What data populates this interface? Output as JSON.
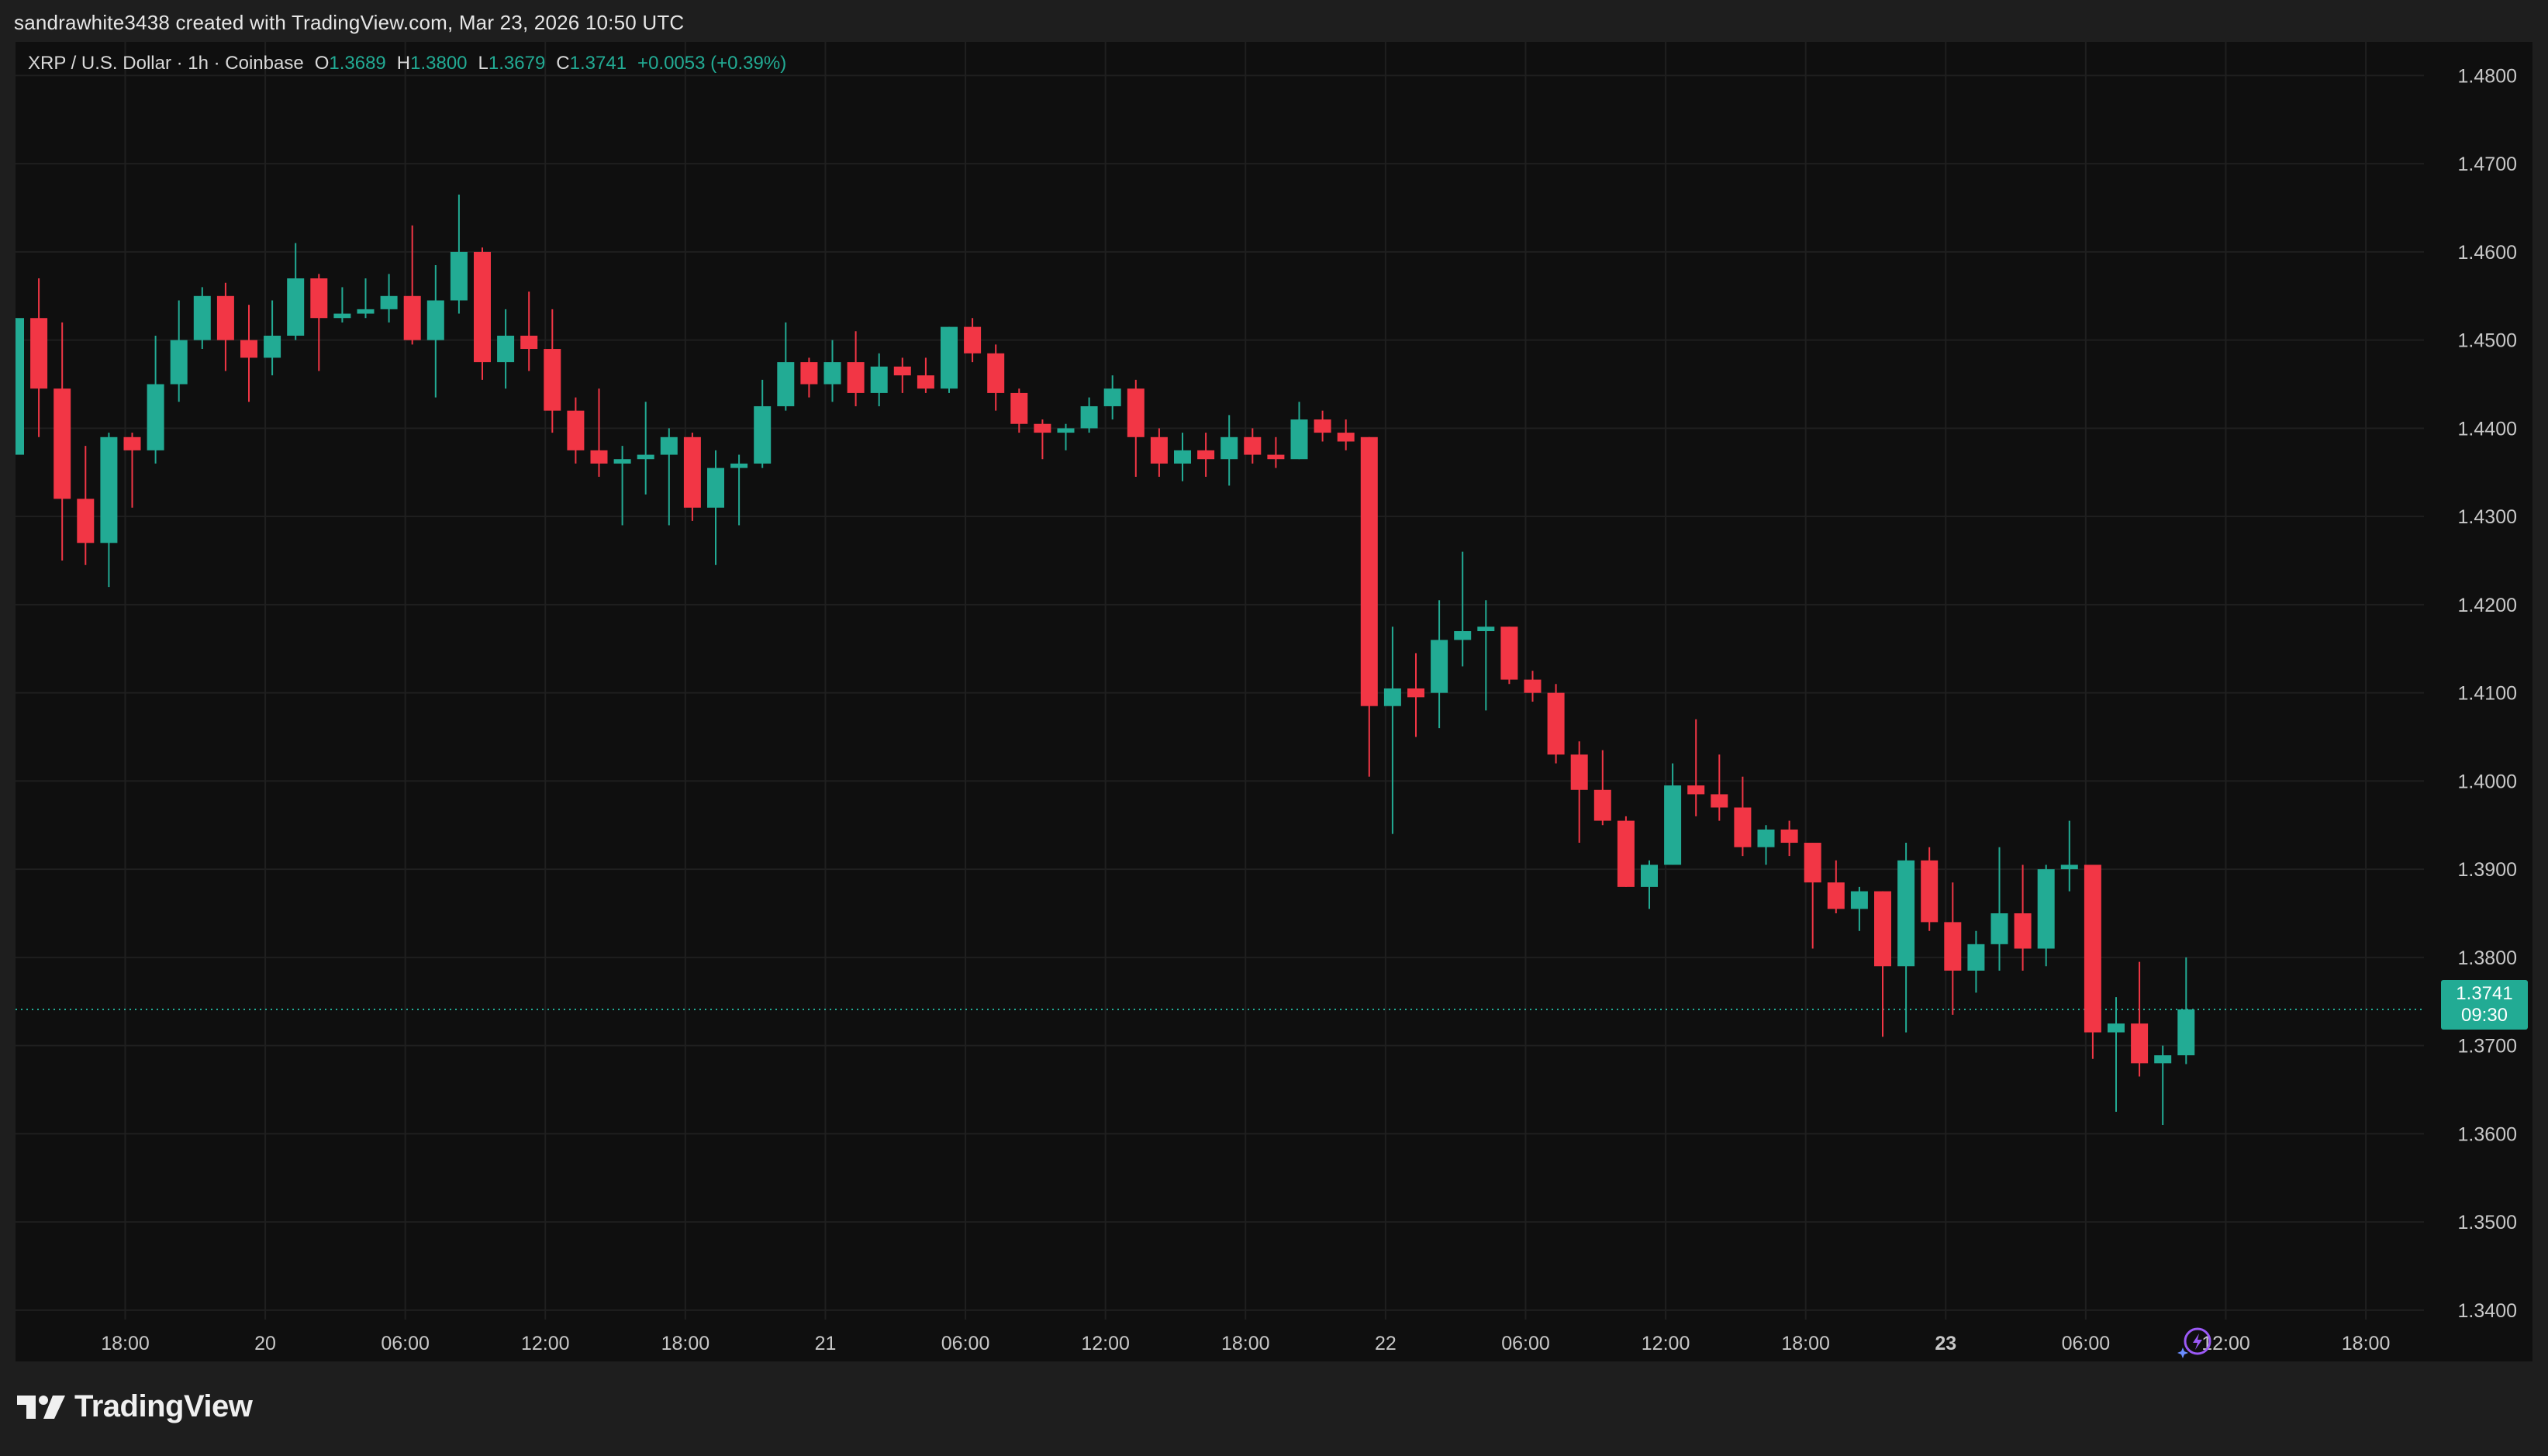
{
  "attribution": "sandrawhite3438 created with TradingView.com, Mar 23, 2026 10:50 UTC",
  "legend": {
    "symbol": "XRP / U.S. Dollar · 1h · Coinbase",
    "o_label": "O",
    "o_value": "1.3689",
    "h_label": "H",
    "h_value": "1.3800",
    "l_label": "L",
    "l_value": "1.3679",
    "c_label": "C",
    "c_value": "1.3741",
    "change": "+0.0053 (+0.39%)"
  },
  "price_badge": {
    "price": "1.3741",
    "countdown": "09:30"
  },
  "logo": {
    "text": "TradingView"
  },
  "colors": {
    "up": "#22ab94",
    "down": "#f23645",
    "grid": "#1f1f1f",
    "axis_text": "#c8c8c8",
    "background": "#0f0f0f"
  },
  "chart_data": {
    "type": "candlestick",
    "symbol": "XRP / U.S. Dollar",
    "interval": "1h",
    "exchange": "Coinbase",
    "ylim": [
      1.337,
      1.4825
    ],
    "y_ticks": [
      "1.4800",
      "1.4700",
      "1.4600",
      "1.4500",
      "1.4400",
      "1.4300",
      "1.4200",
      "1.4100",
      "1.4000",
      "1.3900",
      "1.3800",
      "1.3700",
      "1.3600",
      "1.3500",
      "1.3400"
    ],
    "x_ticks": [
      {
        "label": "18:00",
        "i": 4.7
      },
      {
        "label": "20",
        "i": 10.7
      },
      {
        "label": "06:00",
        "i": 16.7
      },
      {
        "label": "12:00",
        "i": 22.7
      },
      {
        "label": "18:00",
        "i": 28.7
      },
      {
        "label": "21",
        "i": 34.7
      },
      {
        "label": "06:00",
        "i": 40.7
      },
      {
        "label": "12:00",
        "i": 46.7
      },
      {
        "label": "18:00",
        "i": 52.7
      },
      {
        "label": "22",
        "i": 58.7
      },
      {
        "label": "06:00",
        "i": 64.7
      },
      {
        "label": "12:00",
        "i": 70.7
      },
      {
        "label": "18:00",
        "i": 76.7
      },
      {
        "label": "23",
        "i": 82.7,
        "bold": true
      },
      {
        "label": "06:00",
        "i": 88.7
      },
      {
        "label": "12:00",
        "i": 94.7
      },
      {
        "label": "18:00",
        "i": 100.7
      }
    ],
    "last_price": 1.3741,
    "candles": [
      {
        "o": 1.437,
        "h": 1.4525,
        "l": 1.437,
        "c": 1.4525
      },
      {
        "o": 1.4525,
        "h": 1.457,
        "l": 1.439,
        "c": 1.4445
      },
      {
        "o": 1.4445,
        "h": 1.452,
        "l": 1.425,
        "c": 1.432
      },
      {
        "o": 1.432,
        "h": 1.438,
        "l": 1.4245,
        "c": 1.427
      },
      {
        "o": 1.427,
        "h": 1.4395,
        "l": 1.422,
        "c": 1.439
      },
      {
        "o": 1.439,
        "h": 1.4395,
        "l": 1.431,
        "c": 1.4375
      },
      {
        "o": 1.4375,
        "h": 1.4505,
        "l": 1.436,
        "c": 1.445
      },
      {
        "o": 1.445,
        "h": 1.4545,
        "l": 1.443,
        "c": 1.45
      },
      {
        "o": 1.45,
        "h": 1.456,
        "l": 1.449,
        "c": 1.455
      },
      {
        "o": 1.455,
        "h": 1.4565,
        "l": 1.4465,
        "c": 1.45
      },
      {
        "o": 1.45,
        "h": 1.454,
        "l": 1.443,
        "c": 1.448
      },
      {
        "o": 1.448,
        "h": 1.4545,
        "l": 1.446,
        "c": 1.4505
      },
      {
        "o": 1.4505,
        "h": 1.461,
        "l": 1.45,
        "c": 1.457
      },
      {
        "o": 1.457,
        "h": 1.4575,
        "l": 1.4465,
        "c": 1.4525
      },
      {
        "o": 1.4525,
        "h": 1.456,
        "l": 1.452,
        "c": 1.453
      },
      {
        "o": 1.453,
        "h": 1.457,
        "l": 1.4525,
        "c": 1.4535
      },
      {
        "o": 1.4535,
        "h": 1.4575,
        "l": 1.452,
        "c": 1.455
      },
      {
        "o": 1.455,
        "h": 1.463,
        "l": 1.4495,
        "c": 1.45
      },
      {
        "o": 1.45,
        "h": 1.4585,
        "l": 1.4435,
        "c": 1.4545
      },
      {
        "o": 1.4545,
        "h": 1.4665,
        "l": 1.453,
        "c": 1.46
      },
      {
        "o": 1.46,
        "h": 1.4605,
        "l": 1.4455,
        "c": 1.4475
      },
      {
        "o": 1.4475,
        "h": 1.4535,
        "l": 1.4445,
        "c": 1.4505
      },
      {
        "o": 1.4505,
        "h": 1.4555,
        "l": 1.4465,
        "c": 1.449
      },
      {
        "o": 1.449,
        "h": 1.4535,
        "l": 1.4395,
        "c": 1.442
      },
      {
        "o": 1.442,
        "h": 1.4435,
        "l": 1.436,
        "c": 1.4375
      },
      {
        "o": 1.4375,
        "h": 1.4445,
        "l": 1.4345,
        "c": 1.436
      },
      {
        "o": 1.436,
        "h": 1.438,
        "l": 1.429,
        "c": 1.4365
      },
      {
        "o": 1.4365,
        "h": 1.443,
        "l": 1.4325,
        "c": 1.437
      },
      {
        "o": 1.437,
        "h": 1.44,
        "l": 1.429,
        "c": 1.439
      },
      {
        "o": 1.439,
        "h": 1.4395,
        "l": 1.4295,
        "c": 1.431
      },
      {
        "o": 1.431,
        "h": 1.4375,
        "l": 1.4245,
        "c": 1.4355
      },
      {
        "o": 1.4355,
        "h": 1.437,
        "l": 1.429,
        "c": 1.436
      },
      {
        "o": 1.436,
        "h": 1.4455,
        "l": 1.4355,
        "c": 1.4425
      },
      {
        "o": 1.4425,
        "h": 1.452,
        "l": 1.442,
        "c": 1.4475
      },
      {
        "o": 1.4475,
        "h": 1.448,
        "l": 1.4435,
        "c": 1.445
      },
      {
        "o": 1.445,
        "h": 1.45,
        "l": 1.443,
        "c": 1.4475
      },
      {
        "o": 1.4475,
        "h": 1.451,
        "l": 1.4425,
        "c": 1.444
      },
      {
        "o": 1.444,
        "h": 1.4485,
        "l": 1.4425,
        "c": 1.447
      },
      {
        "o": 1.447,
        "h": 1.448,
        "l": 1.444,
        "c": 1.446
      },
      {
        "o": 1.446,
        "h": 1.448,
        "l": 1.444,
        "c": 1.4445
      },
      {
        "o": 1.4445,
        "h": 1.4515,
        "l": 1.444,
        "c": 1.4515
      },
      {
        "o": 1.4515,
        "h": 1.4525,
        "l": 1.4475,
        "c": 1.4485
      },
      {
        "o": 1.4485,
        "h": 1.4495,
        "l": 1.442,
        "c": 1.444
      },
      {
        "o": 1.444,
        "h": 1.4445,
        "l": 1.4395,
        "c": 1.4405
      },
      {
        "o": 1.4405,
        "h": 1.441,
        "l": 1.4365,
        "c": 1.4395
      },
      {
        "o": 1.4395,
        "h": 1.4405,
        "l": 1.4375,
        "c": 1.44
      },
      {
        "o": 1.44,
        "h": 1.4435,
        "l": 1.4395,
        "c": 1.4425
      },
      {
        "o": 1.4425,
        "h": 1.446,
        "l": 1.441,
        "c": 1.4445
      },
      {
        "o": 1.4445,
        "h": 1.4455,
        "l": 1.4345,
        "c": 1.439
      },
      {
        "o": 1.439,
        "h": 1.44,
        "l": 1.4345,
        "c": 1.436
      },
      {
        "o": 1.436,
        "h": 1.4395,
        "l": 1.434,
        "c": 1.4375
      },
      {
        "o": 1.4375,
        "h": 1.4395,
        "l": 1.4345,
        "c": 1.4365
      },
      {
        "o": 1.4365,
        "h": 1.4415,
        "l": 1.4335,
        "c": 1.439
      },
      {
        "o": 1.439,
        "h": 1.44,
        "l": 1.436,
        "c": 1.437
      },
      {
        "o": 1.437,
        "h": 1.439,
        "l": 1.4355,
        "c": 1.4365
      },
      {
        "o": 1.4365,
        "h": 1.443,
        "l": 1.4365,
        "c": 1.441
      },
      {
        "o": 1.441,
        "h": 1.442,
        "l": 1.4385,
        "c": 1.4395
      },
      {
        "o": 1.4395,
        "h": 1.441,
        "l": 1.4375,
        "c": 1.4385
      },
      {
        "o": 1.439,
        "h": 1.439,
        "l": 1.4005,
        "c": 1.4085
      },
      {
        "o": 1.4085,
        "h": 1.4175,
        "l": 1.394,
        "c": 1.4105
      },
      {
        "o": 1.4105,
        "h": 1.4145,
        "l": 1.405,
        "c": 1.4095
      },
      {
        "o": 1.41,
        "h": 1.4205,
        "l": 1.406,
        "c": 1.416
      },
      {
        "o": 1.416,
        "h": 1.426,
        "l": 1.413,
        "c": 1.417
      },
      {
        "o": 1.417,
        "h": 1.4205,
        "l": 1.408,
        "c": 1.4175
      },
      {
        "o": 1.4175,
        "h": 1.4175,
        "l": 1.411,
        "c": 1.4115
      },
      {
        "o": 1.4115,
        "h": 1.4125,
        "l": 1.409,
        "c": 1.41
      },
      {
        "o": 1.41,
        "h": 1.411,
        "l": 1.402,
        "c": 1.403
      },
      {
        "o": 1.403,
        "h": 1.4045,
        "l": 1.393,
        "c": 1.399
      },
      {
        "o": 1.399,
        "h": 1.4035,
        "l": 1.395,
        "c": 1.3955
      },
      {
        "o": 1.3955,
        "h": 1.396,
        "l": 1.388,
        "c": 1.388
      },
      {
        "o": 1.388,
        "h": 1.391,
        "l": 1.3855,
        "c": 1.3905
      },
      {
        "o": 1.3905,
        "h": 1.402,
        "l": 1.3905,
        "c": 1.3995
      },
      {
        "o": 1.3995,
        "h": 1.407,
        "l": 1.396,
        "c": 1.3985
      },
      {
        "o": 1.3985,
        "h": 1.403,
        "l": 1.3955,
        "c": 1.397
      },
      {
        "o": 1.397,
        "h": 1.4005,
        "l": 1.3915,
        "c": 1.3925
      },
      {
        "o": 1.3925,
        "h": 1.395,
        "l": 1.3905,
        "c": 1.3945
      },
      {
        "o": 1.3945,
        "h": 1.3955,
        "l": 1.3915,
        "c": 1.393
      },
      {
        "o": 1.393,
        "h": 1.393,
        "l": 1.381,
        "c": 1.3885
      },
      {
        "o": 1.3885,
        "h": 1.391,
        "l": 1.385,
        "c": 1.3855
      },
      {
        "o": 1.3855,
        "h": 1.388,
        "l": 1.383,
        "c": 1.3875
      },
      {
        "o": 1.3875,
        "h": 1.3875,
        "l": 1.371,
        "c": 1.379
      },
      {
        "o": 1.379,
        "h": 1.393,
        "l": 1.3715,
        "c": 1.391
      },
      {
        "o": 1.391,
        "h": 1.3925,
        "l": 1.383,
        "c": 1.384
      },
      {
        "o": 1.384,
        "h": 1.3885,
        "l": 1.3735,
        "c": 1.3785
      },
      {
        "o": 1.3785,
        "h": 1.383,
        "l": 1.376,
        "c": 1.3815
      },
      {
        "o": 1.3815,
        "h": 1.3925,
        "l": 1.3785,
        "c": 1.385
      },
      {
        "o": 1.385,
        "h": 1.3905,
        "l": 1.3785,
        "c": 1.381
      },
      {
        "o": 1.381,
        "h": 1.3905,
        "l": 1.379,
        "c": 1.39
      },
      {
        "o": 1.39,
        "h": 1.3955,
        "l": 1.3875,
        "c": 1.3905
      },
      {
        "o": 1.3905,
        "h": 1.3905,
        "l": 1.3685,
        "c": 1.3715
      },
      {
        "o": 1.3715,
        "h": 1.3755,
        "l": 1.3625,
        "c": 1.3725
      },
      {
        "o": 1.3725,
        "h": 1.3795,
        "l": 1.3665,
        "c": 1.368
      },
      {
        "o": 1.368,
        "h": 1.37,
        "l": 1.361,
        "c": 1.3689
      },
      {
        "o": 1.3689,
        "h": 1.38,
        "l": 1.3679,
        "c": 1.3741
      }
    ]
  }
}
